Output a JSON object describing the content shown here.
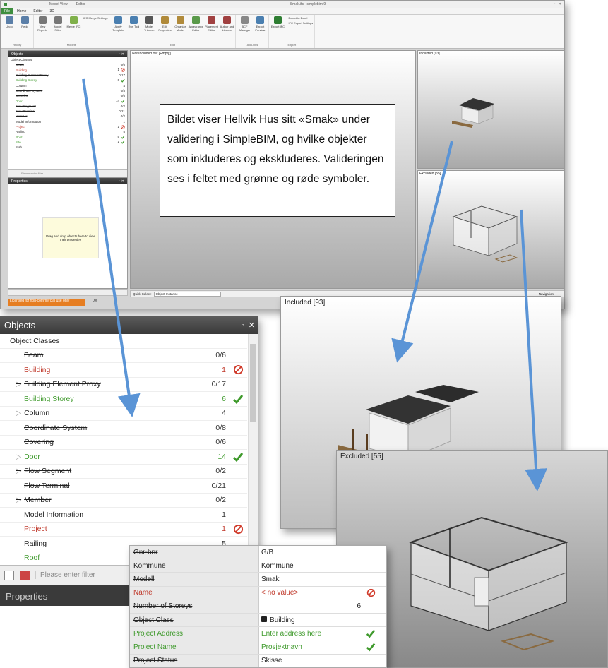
{
  "window": {
    "title": "Smak.ifc - simplebim 9",
    "tabs_top": [
      "Model View",
      "Editor"
    ],
    "menu": [
      "File",
      "Home",
      "Editor",
      "3D"
    ],
    "controls": "▫ - ✕"
  },
  "ribbon": {
    "groups": [
      {
        "label": "History",
        "buttons": [
          {
            "label": "Undo",
            "color": "#5b7fa8"
          },
          {
            "label": "Redo",
            "color": "#5b7fa8"
          }
        ]
      },
      {
        "label": "Models",
        "buttons": [
          {
            "label": "View Reports",
            "color": "#777"
          },
          {
            "label": "Model Filter",
            "color": "#777"
          },
          {
            "label": "Merge IFC",
            "color": "#7fb04a"
          }
        ],
        "extra": "IFC Merge Settings"
      },
      {
        "label": "Edit",
        "buttons": [
          {
            "label": "Apply Template",
            "color": "#4a7fb0"
          },
          {
            "label": "Run Tool",
            "color": "#4a7fb0"
          },
          {
            "label": "Model Trimmer",
            "color": "#555"
          },
          {
            "label": "Edit Properties",
            "color": "#b08a3a"
          },
          {
            "label": "Organize Model",
            "color": "#b08a3a"
          },
          {
            "label": "Appearance Editor",
            "color": "#5a9a4a"
          },
          {
            "label": "Placement Editor",
            "color": "#a04040"
          },
          {
            "label": "Author and License",
            "color": "#a04040"
          }
        ]
      },
      {
        "label": "Add-Ons",
        "buttons": [
          {
            "label": "BCF Manager",
            "color": "#888"
          },
          {
            "label": "Export Preview",
            "color": "#4a7fb0"
          }
        ]
      },
      {
        "label": "Export",
        "buttons": [
          {
            "label": "Export IFC",
            "color": "#2e7d32"
          }
        ],
        "links": [
          "Export to Excel",
          "IFC Export Settings"
        ]
      }
    ]
  },
  "objects_panel": {
    "title": "Objects",
    "root": "Object Classes",
    "filter_placeholder": "Please enter filter",
    "rows": [
      {
        "name": "Beam",
        "count": "0/6",
        "style": "strk",
        "icon": ""
      },
      {
        "name": "Building",
        "count": "1",
        "style": "red",
        "icon": "no"
      },
      {
        "name": "Building Element Proxy",
        "count": "0/17",
        "style": "strk",
        "icon": "",
        "exp": true
      },
      {
        "name": "Building Storey",
        "count": "6",
        "style": "grn",
        "icon": "ok"
      },
      {
        "name": "Column",
        "count": "4",
        "style": "",
        "icon": "",
        "exp": true
      },
      {
        "name": "Coordinate System",
        "count": "0/8",
        "style": "strk",
        "icon": ""
      },
      {
        "name": "Covering",
        "count": "0/6",
        "style": "strk",
        "icon": ""
      },
      {
        "name": "Door",
        "count": "14",
        "style": "grn",
        "icon": "ok",
        "exp": true
      },
      {
        "name": "Flow Segment",
        "count": "0/2",
        "style": "strk",
        "icon": "",
        "exp": true
      },
      {
        "name": "Flow Terminal",
        "count": "0/21",
        "style": "strk",
        "icon": ""
      },
      {
        "name": "Member",
        "count": "0/2",
        "style": "strk",
        "icon": "",
        "exp": true
      },
      {
        "name": "Model Information",
        "count": "1",
        "style": "",
        "icon": ""
      },
      {
        "name": "Project",
        "count": "1",
        "style": "red",
        "icon": "no"
      },
      {
        "name": "Railing",
        "count": "5",
        "style": "",
        "icon": ""
      },
      {
        "name": "Roof",
        "count": "5",
        "style": "grn",
        "icon": "ok"
      },
      {
        "name": "Site",
        "count": "1",
        "style": "grn",
        "icon": "ok"
      },
      {
        "name": "Slab",
        "count": "",
        "style": "",
        "icon": ""
      }
    ]
  },
  "properties_panel": {
    "title": "Properties",
    "dropzone": "Drag and drop objects here to view their properties"
  },
  "viewports": {
    "main": "Not Included Yet [Empty]",
    "included": "Included [93]",
    "excluded": "Excluded [55]",
    "quick_select_label": "Quick Select:",
    "quick_select_value": "Object Instance",
    "navigation": "Navigation"
  },
  "status": {
    "license": "Licensed for non-commercial use only",
    "zoom": "0%"
  },
  "callout": "Bildet viser Hellvik Hus sitt «Smak» under validering i SimpleBIM, og hvilke objekter som inkluderes og ekskluderes. Valideringen ses i feltet med grønne og røde symboler.",
  "zoom_included_label": "Included [93]",
  "zoom_excluded_label": "Excluded [55]",
  "properties_zoom": [
    {
      "k": "Gnr-bnr",
      "v": "G/B",
      "ks": "strk",
      "icon": ""
    },
    {
      "k": "Kommune",
      "v": "Kommune",
      "ks": "strk",
      "icon": ""
    },
    {
      "k": "Modell",
      "v": "Smak",
      "ks": "strk",
      "icon": ""
    },
    {
      "k": "Name",
      "v": "< no value>",
      "ks": "red",
      "vs": "red",
      "icon": "no"
    },
    {
      "k": "Number of Storeys",
      "v": "6",
      "ks": "strk",
      "icon": "",
      "num": true
    },
    {
      "k": "Object Class",
      "v": "Building",
      "ks": "strk",
      "icon": "",
      "lock": true
    },
    {
      "k": "Project Address",
      "v": "Enter address here",
      "ks": "grn",
      "vs": "grn",
      "icon": "ok"
    },
    {
      "k": "Project Name",
      "v": "Prosjektnavn",
      "ks": "grn",
      "vs": "grn",
      "icon": "ok"
    },
    {
      "k": "Project Status",
      "v": "Skisse",
      "ks": "strk",
      "icon": ""
    }
  ]
}
